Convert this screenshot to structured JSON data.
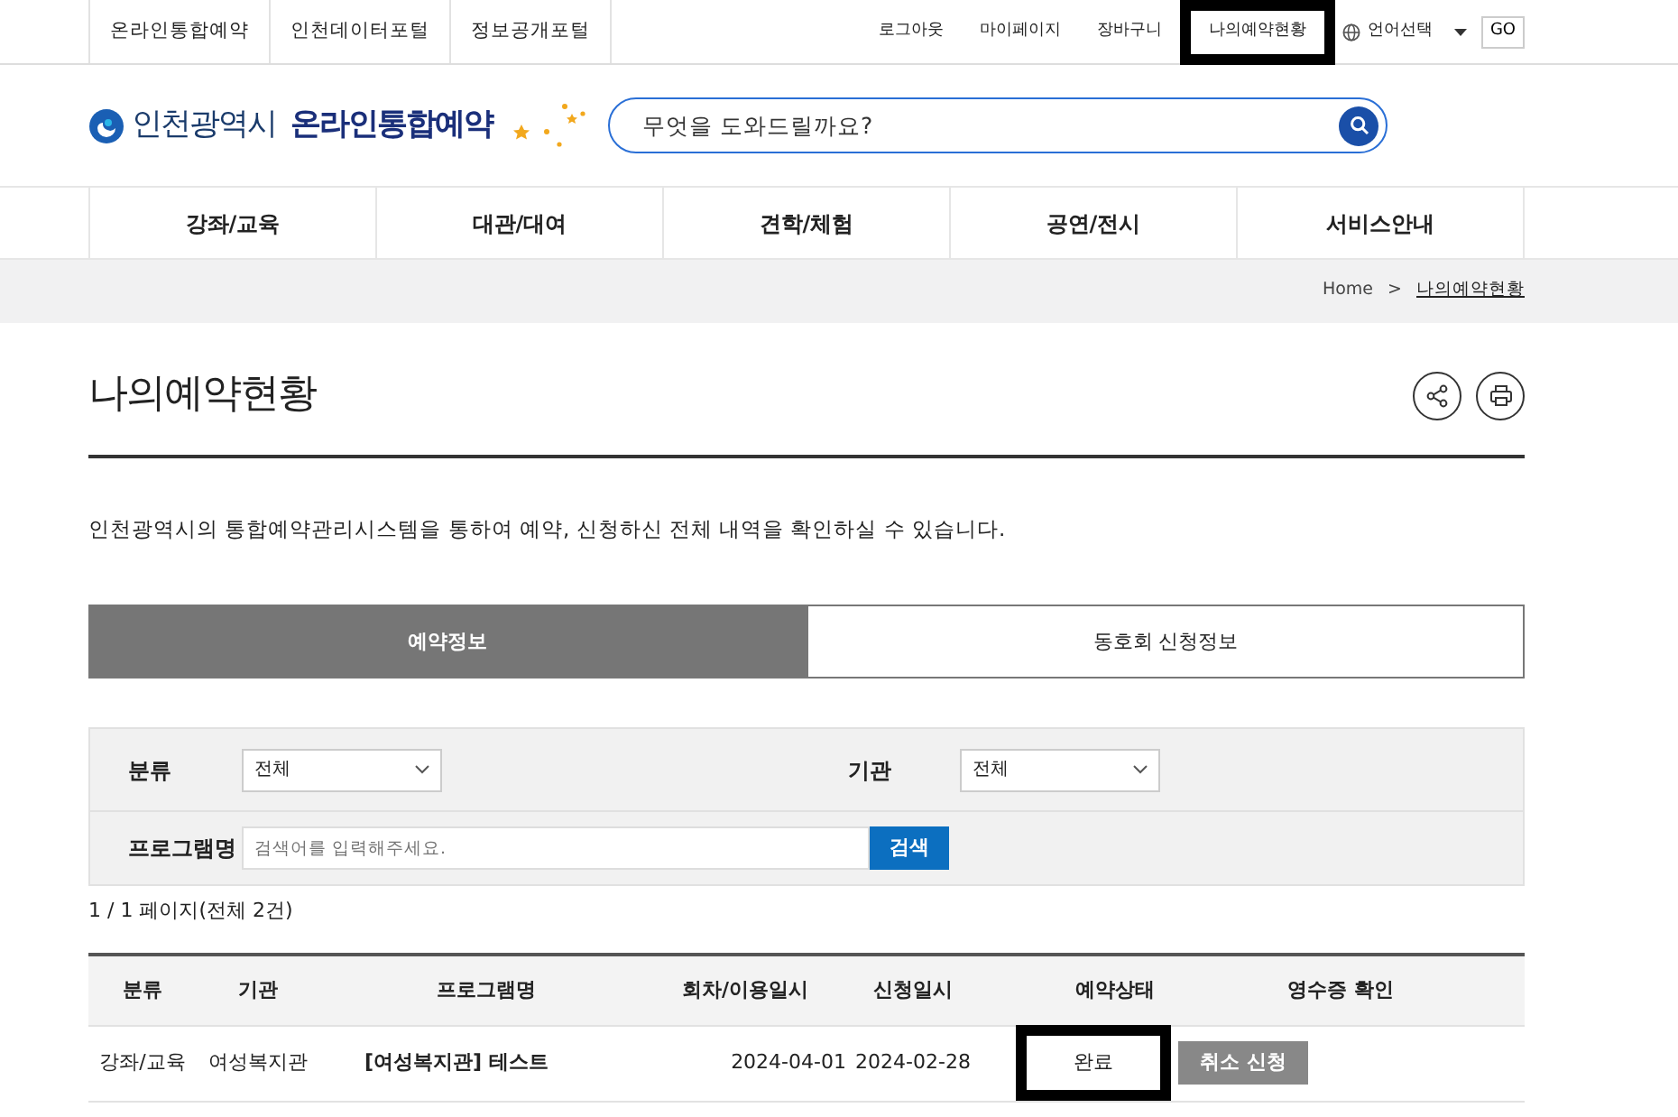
{
  "top_links": [
    {
      "label": "온라인통합예약"
    },
    {
      "label": "인천데이터포털"
    },
    {
      "label": "정보공개포털"
    }
  ],
  "user_links": [
    {
      "label": "로그아웃",
      "highlighted": false
    },
    {
      "label": "마이페이지",
      "highlighted": false
    },
    {
      "label": "장바구니",
      "highlighted": false
    },
    {
      "label": "나의예약현황",
      "highlighted": true
    }
  ],
  "language": {
    "label": "언어선택",
    "go": "GO"
  },
  "logo": {
    "city": "인천광역시",
    "service": "온라인통합예약"
  },
  "search": {
    "placeholder": "무엇을 도와드릴까요?"
  },
  "main_menu": [
    {
      "label": "강좌/교육"
    },
    {
      "label": "대관/대여"
    },
    {
      "label": "견학/체험"
    },
    {
      "label": "공연/전시"
    },
    {
      "label": "서비스안내"
    }
  ],
  "breadcrumb": [
    {
      "label": "Home"
    },
    {
      "label": "나의예약현황"
    }
  ],
  "breadcrumb_separator": ">",
  "page_title": "나의예약현황",
  "description": "인천광역시의 통합예약관리시스템을 통하여 예약, 신청하신 전체 내역을 확인하실 수 있습니다.",
  "tabs": [
    {
      "label": "예약정보",
      "selected": true
    },
    {
      "label": "동호회 신청정보",
      "selected": false
    }
  ],
  "filters": {
    "category_label": "분류",
    "category_value": "전체",
    "agency_label": "기관",
    "agency_value": "전체",
    "program_label": "프로그램명",
    "program_placeholder": "검색어를 입력해주세요.",
    "search_button": "검색"
  },
  "page_info": "1 / 1 페이지(전체 2건)",
  "table": {
    "columns": [
      "분류",
      "기관",
      "프로그램명",
      "회차/이용일시",
      "신청일시",
      "예약상태",
      "영수증 확인"
    ],
    "rows": [
      {
        "category": "강좌/교육",
        "agency": "여성복지관",
        "program": "[여성복지관] 테스트",
        "session_date": "2024-04-01",
        "applied_date": "2024-02-28",
        "status": "완료",
        "status_highlighted": true,
        "action": "취소 신청"
      }
    ]
  }
}
